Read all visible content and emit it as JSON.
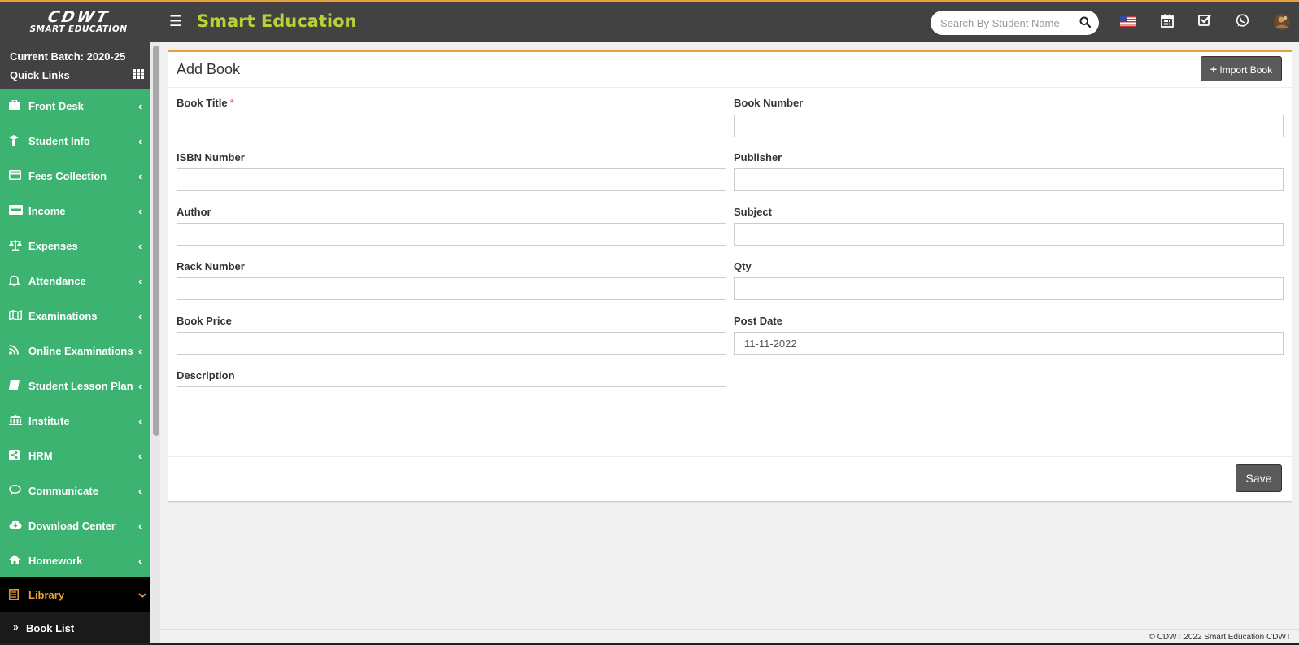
{
  "header": {
    "logo_mark": "CDWT",
    "logo_sub": "SMART EDUCATION",
    "title": "Smart Education",
    "search_placeholder": "Search By Student Name"
  },
  "header_icons": [
    "flag-us-icon",
    "calendar-icon",
    "checkbox-icon",
    "whatsapp-icon",
    "user-avatar-icon"
  ],
  "sidebar": {
    "current_batch": "Current Batch: 2020-25",
    "quick_links": "Quick Links",
    "items": [
      {
        "label": "Front Desk",
        "icon": "briefcase-icon"
      },
      {
        "label": "Student Info",
        "icon": "student-icon"
      },
      {
        "label": "Fees Collection",
        "icon": "credit-card-icon"
      },
      {
        "label": "Income",
        "icon": "visa-card-icon"
      },
      {
        "label": "Expenses",
        "icon": "balance-scale-icon"
      },
      {
        "label": "Attendance",
        "icon": "bell-icon"
      },
      {
        "label": "Examinations",
        "icon": "map-icon"
      },
      {
        "label": "Online Examinations",
        "icon": "rss-icon"
      },
      {
        "label": "Student Lesson Plan",
        "icon": "book-icon"
      },
      {
        "label": "Institute",
        "icon": "bank-icon"
      },
      {
        "label": "HRM",
        "icon": "share-icon"
      },
      {
        "label": "Communicate",
        "icon": "comments-icon"
      },
      {
        "label": "Download Center",
        "icon": "cloud-download-icon"
      },
      {
        "label": "Homework",
        "icon": "home-icon"
      },
      {
        "label": "Library",
        "icon": "library-book-icon",
        "active": true
      }
    ],
    "submenu_item": "Book List"
  },
  "form": {
    "title": "Add Book",
    "import_label": "Import Book",
    "required_mark": "*",
    "fields": {
      "book_title": {
        "label": "Book Title",
        "value": ""
      },
      "book_number": {
        "label": "Book Number",
        "value": ""
      },
      "isbn_number": {
        "label": "ISBN Number",
        "value": ""
      },
      "publisher": {
        "label": "Publisher",
        "value": ""
      },
      "author": {
        "label": "Author",
        "value": ""
      },
      "subject": {
        "label": "Subject",
        "value": ""
      },
      "rack_number": {
        "label": "Rack Number",
        "value": ""
      },
      "qty": {
        "label": "Qty",
        "value": ""
      },
      "book_price": {
        "label": "Book Price",
        "value": ""
      },
      "post_date": {
        "label": "Post Date",
        "value": "11-11-2022"
      },
      "description": {
        "label": "Description",
        "value": ""
      }
    },
    "save_label": "Save"
  },
  "footer": {
    "text": "© CDWT 2022 Smart Education CDWT"
  },
  "colors": {
    "header_bg": "#424242",
    "sidebar_bg": "#3cb371",
    "title_green": "#b5d334",
    "accent_orange": "#e8a13a",
    "button_gray": "#5a5a5a"
  }
}
